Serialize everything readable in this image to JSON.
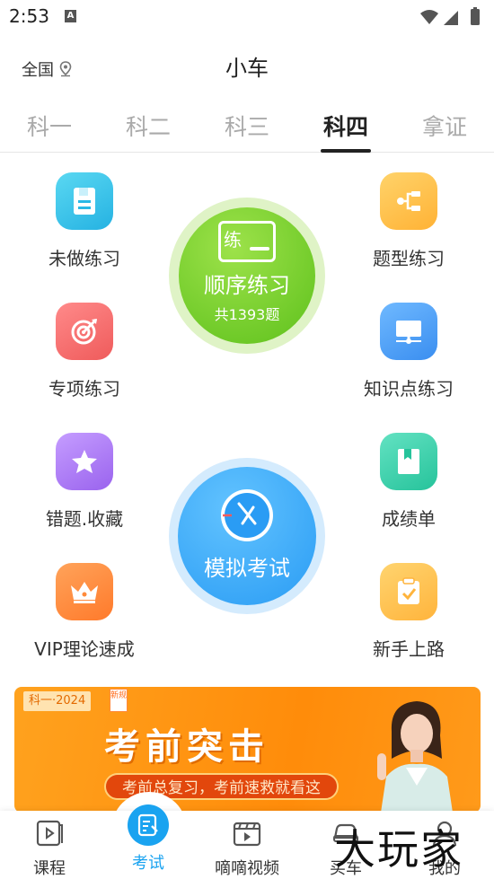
{
  "status_bar": {
    "time": "2:53",
    "notification_icon": "A"
  },
  "header": {
    "region": "全国",
    "title": "小车"
  },
  "tabs": [
    {
      "label": "科一",
      "active": false
    },
    {
      "label": "科二",
      "active": false
    },
    {
      "label": "科三",
      "active": false
    },
    {
      "label": "科四",
      "active": true
    },
    {
      "label": "拿证",
      "active": false
    }
  ],
  "features": {
    "unanswered": {
      "label": "未做练习",
      "icon": "document-icon",
      "color": "#2ab8e6"
    },
    "question_type": {
      "label": "题型练习",
      "icon": "branch-icon",
      "color": "#ffb235"
    },
    "special": {
      "label": "专项练习",
      "icon": "target-icon",
      "color": "#ef5b5b"
    },
    "knowledge": {
      "label": "知识点练习",
      "icon": "monitor-icon",
      "color": "#3a8ef0"
    },
    "mistakes": {
      "label": "错题.收藏",
      "icon": "star-icon",
      "color": "#9a63ee"
    },
    "scores": {
      "label": "成绩单",
      "icon": "book-icon",
      "color": "#26c39b"
    },
    "vip": {
      "label": "VIP理论速成",
      "icon": "crown-icon",
      "color": "#ff7a2b"
    },
    "newbie": {
      "label": "新手上路",
      "icon": "checklist-icon",
      "color": "#ffb43c"
    }
  },
  "sequential_practice": {
    "badge": "练",
    "title": "顺序练习",
    "count_text": "共1393题"
  },
  "mock_exam": {
    "title": "模拟考试"
  },
  "banner": {
    "tag": "科一·2024",
    "tag_new": "新规",
    "headline": "考前突击",
    "subline": "考前总复习，考前速救就看这"
  },
  "bottom_nav": [
    {
      "label": "课程",
      "icon": "play-book-icon",
      "active": false
    },
    {
      "label": "考试",
      "icon": "exam-icon",
      "active": true
    },
    {
      "label": "嘀嘀视频",
      "icon": "video-icon",
      "active": false
    },
    {
      "label": "买车",
      "icon": "car-icon",
      "active": false
    },
    {
      "label": "我的",
      "icon": "user-icon",
      "active": false
    }
  ],
  "watermark": "大玩家"
}
